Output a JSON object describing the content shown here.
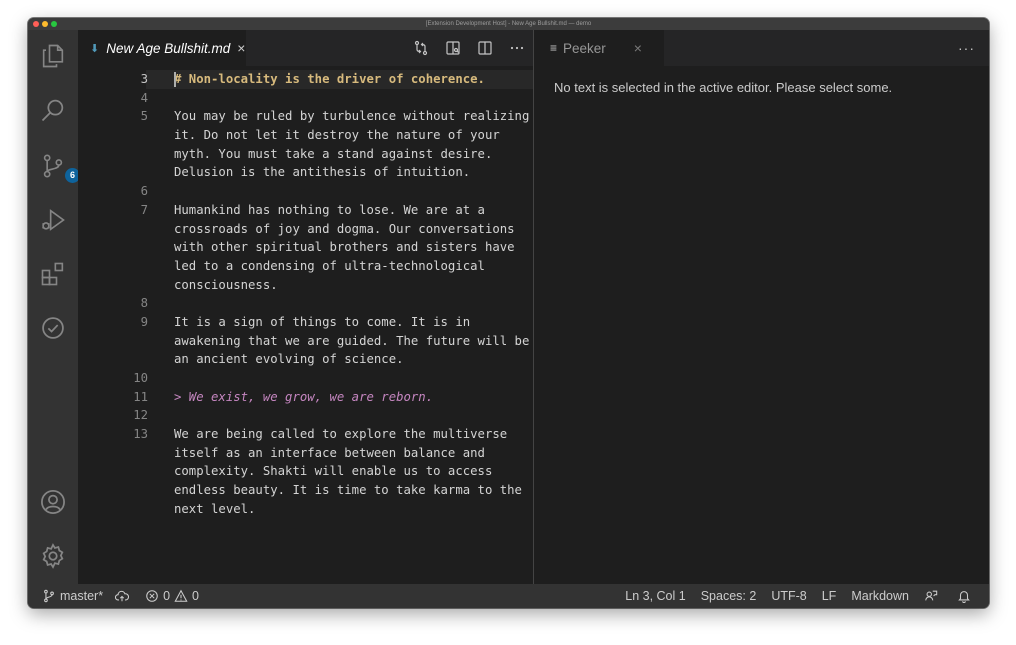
{
  "window": {
    "title": "[Extension Development Host] - New Age Bullshit.md — demo"
  },
  "activity_bar": {
    "items": [
      {
        "icon": "files-icon"
      },
      {
        "icon": "search-icon"
      },
      {
        "icon": "source-control-icon",
        "badge": "6"
      },
      {
        "icon": "run-debug-icon"
      },
      {
        "icon": "extensions-icon"
      },
      {
        "icon": "check-circle-icon"
      }
    ],
    "bottom": [
      {
        "icon": "account-icon"
      },
      {
        "icon": "settings-gear-icon"
      }
    ]
  },
  "editor_left": {
    "tab": {
      "label": "New Age Bullshit.md",
      "close": "×"
    },
    "actions": [
      "open-changes-icon",
      "open-preview-icon",
      "split-editor-icon",
      "more-actions-icon"
    ],
    "lines": [
      {
        "n": "3",
        "t": "# Non-locality is the driver of coherence.",
        "kind": "header"
      },
      {
        "n": "4",
        "t": ""
      },
      {
        "n": "5",
        "t": "You may be ruled by turbulence without realizing"
      },
      {
        "n": "",
        "t": "it. Do not let it destroy the nature of your"
      },
      {
        "n": "",
        "t": "myth. You must take a stand against desire."
      },
      {
        "n": "",
        "t": "Delusion is the antithesis of intuition."
      },
      {
        "n": "6",
        "t": ""
      },
      {
        "n": "7",
        "t": "Humankind has nothing to lose. We are at a"
      },
      {
        "n": "",
        "t": "crossroads of joy and dogma. Our conversations"
      },
      {
        "n": "",
        "t": "with other spiritual brothers and sisters have"
      },
      {
        "n": "",
        "t": "led to a condensing of ultra-technological"
      },
      {
        "n": "",
        "t": "consciousness."
      },
      {
        "n": "8",
        "t": ""
      },
      {
        "n": "9",
        "t": "It is a sign of things to come. It is in"
      },
      {
        "n": "",
        "t": "awakening that we are guided. The future will be"
      },
      {
        "n": "",
        "t": "an ancient evolving of science."
      },
      {
        "n": "10",
        "t": ""
      },
      {
        "n": "11",
        "t": "> We exist, we grow, we are reborn.",
        "kind": "quote"
      },
      {
        "n": "12",
        "t": ""
      },
      {
        "n": "13",
        "t": "We are being called to explore the multiverse"
      },
      {
        "n": "",
        "t": "itself as an interface between balance and"
      },
      {
        "n": "",
        "t": "complexity. Shakti will enable us to access"
      },
      {
        "n": "",
        "t": "endless beauty. It is time to take karma to the"
      },
      {
        "n": "",
        "t": "next level."
      }
    ]
  },
  "editor_right": {
    "tab": {
      "label": "Peeker",
      "close": "×"
    },
    "more": "···",
    "message": "No text is selected in the active editor. Please select some."
  },
  "status_bar": {
    "branch": "master*",
    "errors": "0",
    "warnings": "0",
    "position": "Ln 3, Col 1",
    "spaces": "Spaces: 2",
    "encoding": "UTF-8",
    "eol": "LF",
    "language": "Markdown"
  }
}
